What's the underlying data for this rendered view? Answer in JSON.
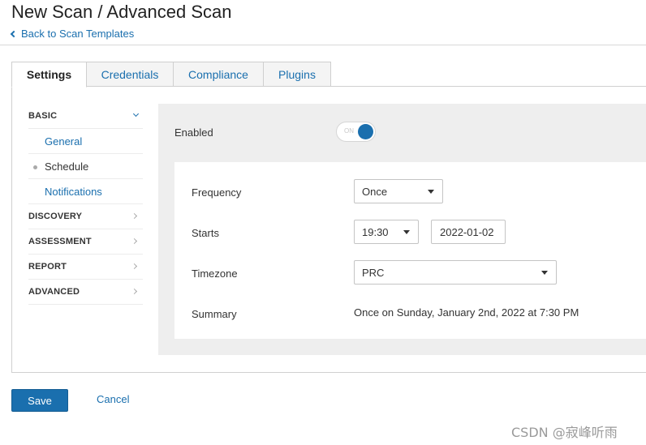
{
  "header": {
    "title": "New Scan / Advanced Scan",
    "back_link": "Back to Scan Templates"
  },
  "tabs": [
    {
      "label": "Settings",
      "active": true
    },
    {
      "label": "Credentials",
      "active": false
    },
    {
      "label": "Compliance",
      "active": false
    },
    {
      "label": "Plugins",
      "active": false
    }
  ],
  "sidebar": {
    "basic": {
      "label": "BASIC",
      "items": [
        "General",
        "Schedule",
        "Notifications"
      ],
      "current": "Schedule"
    },
    "sections": [
      "DISCOVERY",
      "ASSESSMENT",
      "REPORT",
      "ADVANCED"
    ]
  },
  "schedule": {
    "enabled_label": "Enabled",
    "toggle_text": "ON",
    "frequency_label": "Frequency",
    "frequency_value": "Once",
    "starts_label": "Starts",
    "start_time": "19:30",
    "start_date": "2022-01-02",
    "timezone_label": "Timezone",
    "timezone_value": "PRC",
    "summary_label": "Summary",
    "summary_value": "Once on Sunday, January 2nd, 2022 at 7:30 PM"
  },
  "footer": {
    "save_label": "Save",
    "cancel_label": "Cancel"
  },
  "watermark": "CSDN @寂峰听雨",
  "colors": {
    "accent": "#1a6fae",
    "panel_bg": "#eeeeee"
  }
}
